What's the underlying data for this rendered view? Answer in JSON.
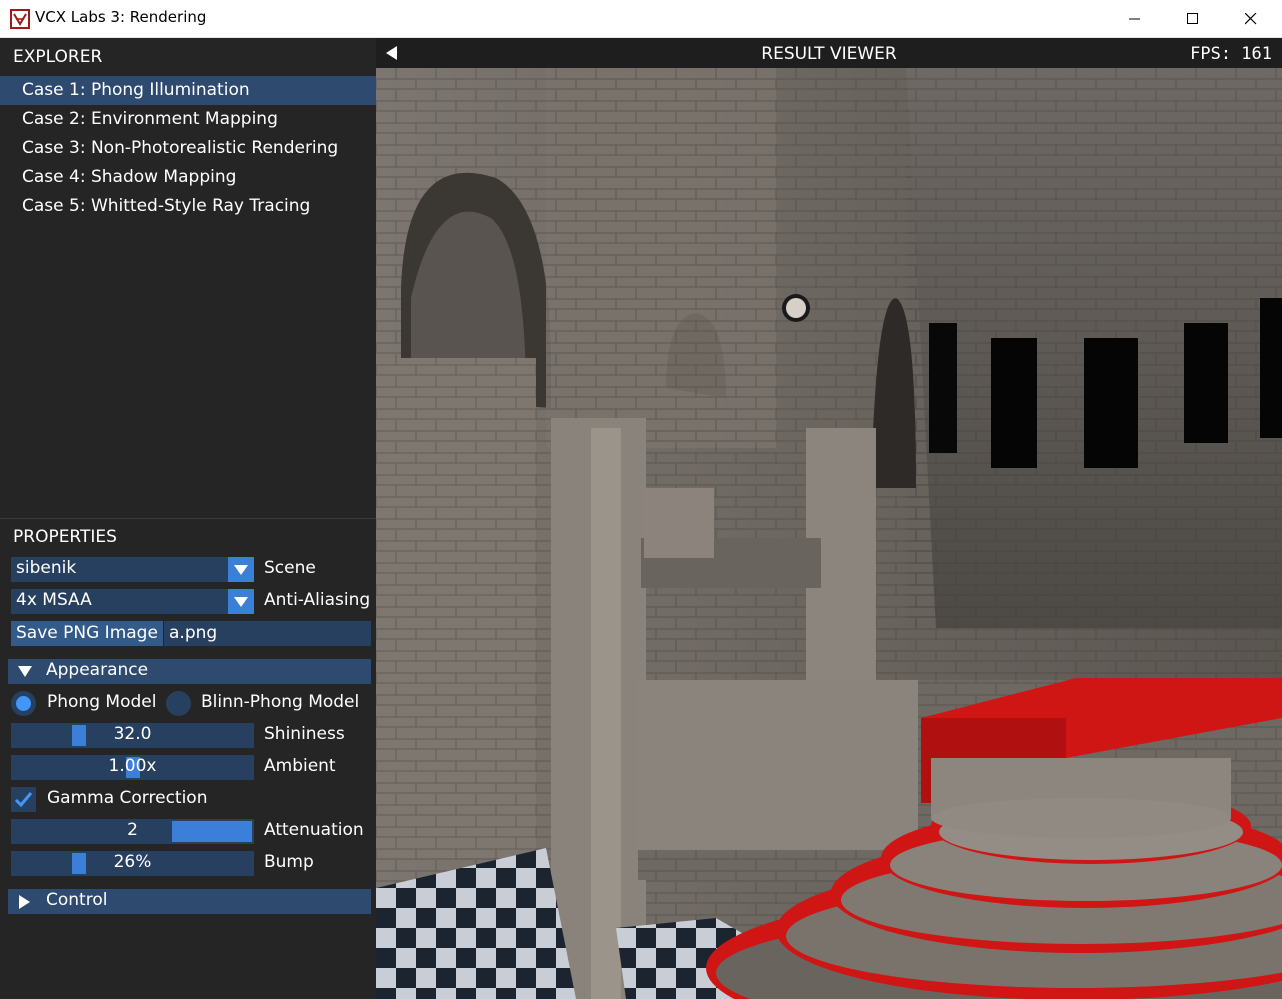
{
  "window": {
    "title": "VCX Labs 3: Rendering",
    "min_icon": "minimize-icon",
    "max_icon": "maximize-icon",
    "close_icon": "close-icon"
  },
  "explorer": {
    "header": "EXPLORER",
    "cases": [
      {
        "label": "Case 1: Phong Illumination",
        "selected": true
      },
      {
        "label": "Case 2: Environment Mapping",
        "selected": false
      },
      {
        "label": "Case 3: Non-Photorealistic Rendering",
        "selected": false
      },
      {
        "label": "Case 4: Shadow Mapping",
        "selected": false
      },
      {
        "label": "Case 5: Whitted-Style Ray Tracing",
        "selected": false
      }
    ]
  },
  "properties": {
    "header": "PROPERTIES",
    "scene": {
      "value": "sibenik",
      "label": "Scene"
    },
    "anti_aliasing": {
      "value": "4x MSAA",
      "label": "Anti-Aliasing"
    },
    "save": {
      "button": "Save PNG Image",
      "filename": "a.png"
    },
    "appearance": {
      "header": "Appearance",
      "expanded": true,
      "radio_phong": {
        "label": "Phong Model",
        "selected": true
      },
      "radio_blinn": {
        "label": "Blinn-Phong Model",
        "selected": false
      },
      "shininess": {
        "value": "32.0",
        "label": "Shininess",
        "fraction": 0.26
      },
      "ambient": {
        "value": "1.00x",
        "label": "Ambient",
        "fraction": 0.5
      },
      "gamma": {
        "label": "Gamma Correction",
        "checked": true
      },
      "attenuation": {
        "value": "2",
        "label": "Attenuation",
        "fraction": 1.0
      },
      "bump": {
        "value": "26%",
        "label": "Bump",
        "fraction": 0.26
      }
    },
    "control": {
      "header": "Control",
      "expanded": false
    }
  },
  "viewer": {
    "title": "RESULT VIEWER",
    "fps": "FPS:  161"
  },
  "colors": {
    "accent": "#4296fa",
    "frame_bg": "#28405f",
    "header_bg": "#2e4a6e",
    "carpet": "#d01515"
  }
}
